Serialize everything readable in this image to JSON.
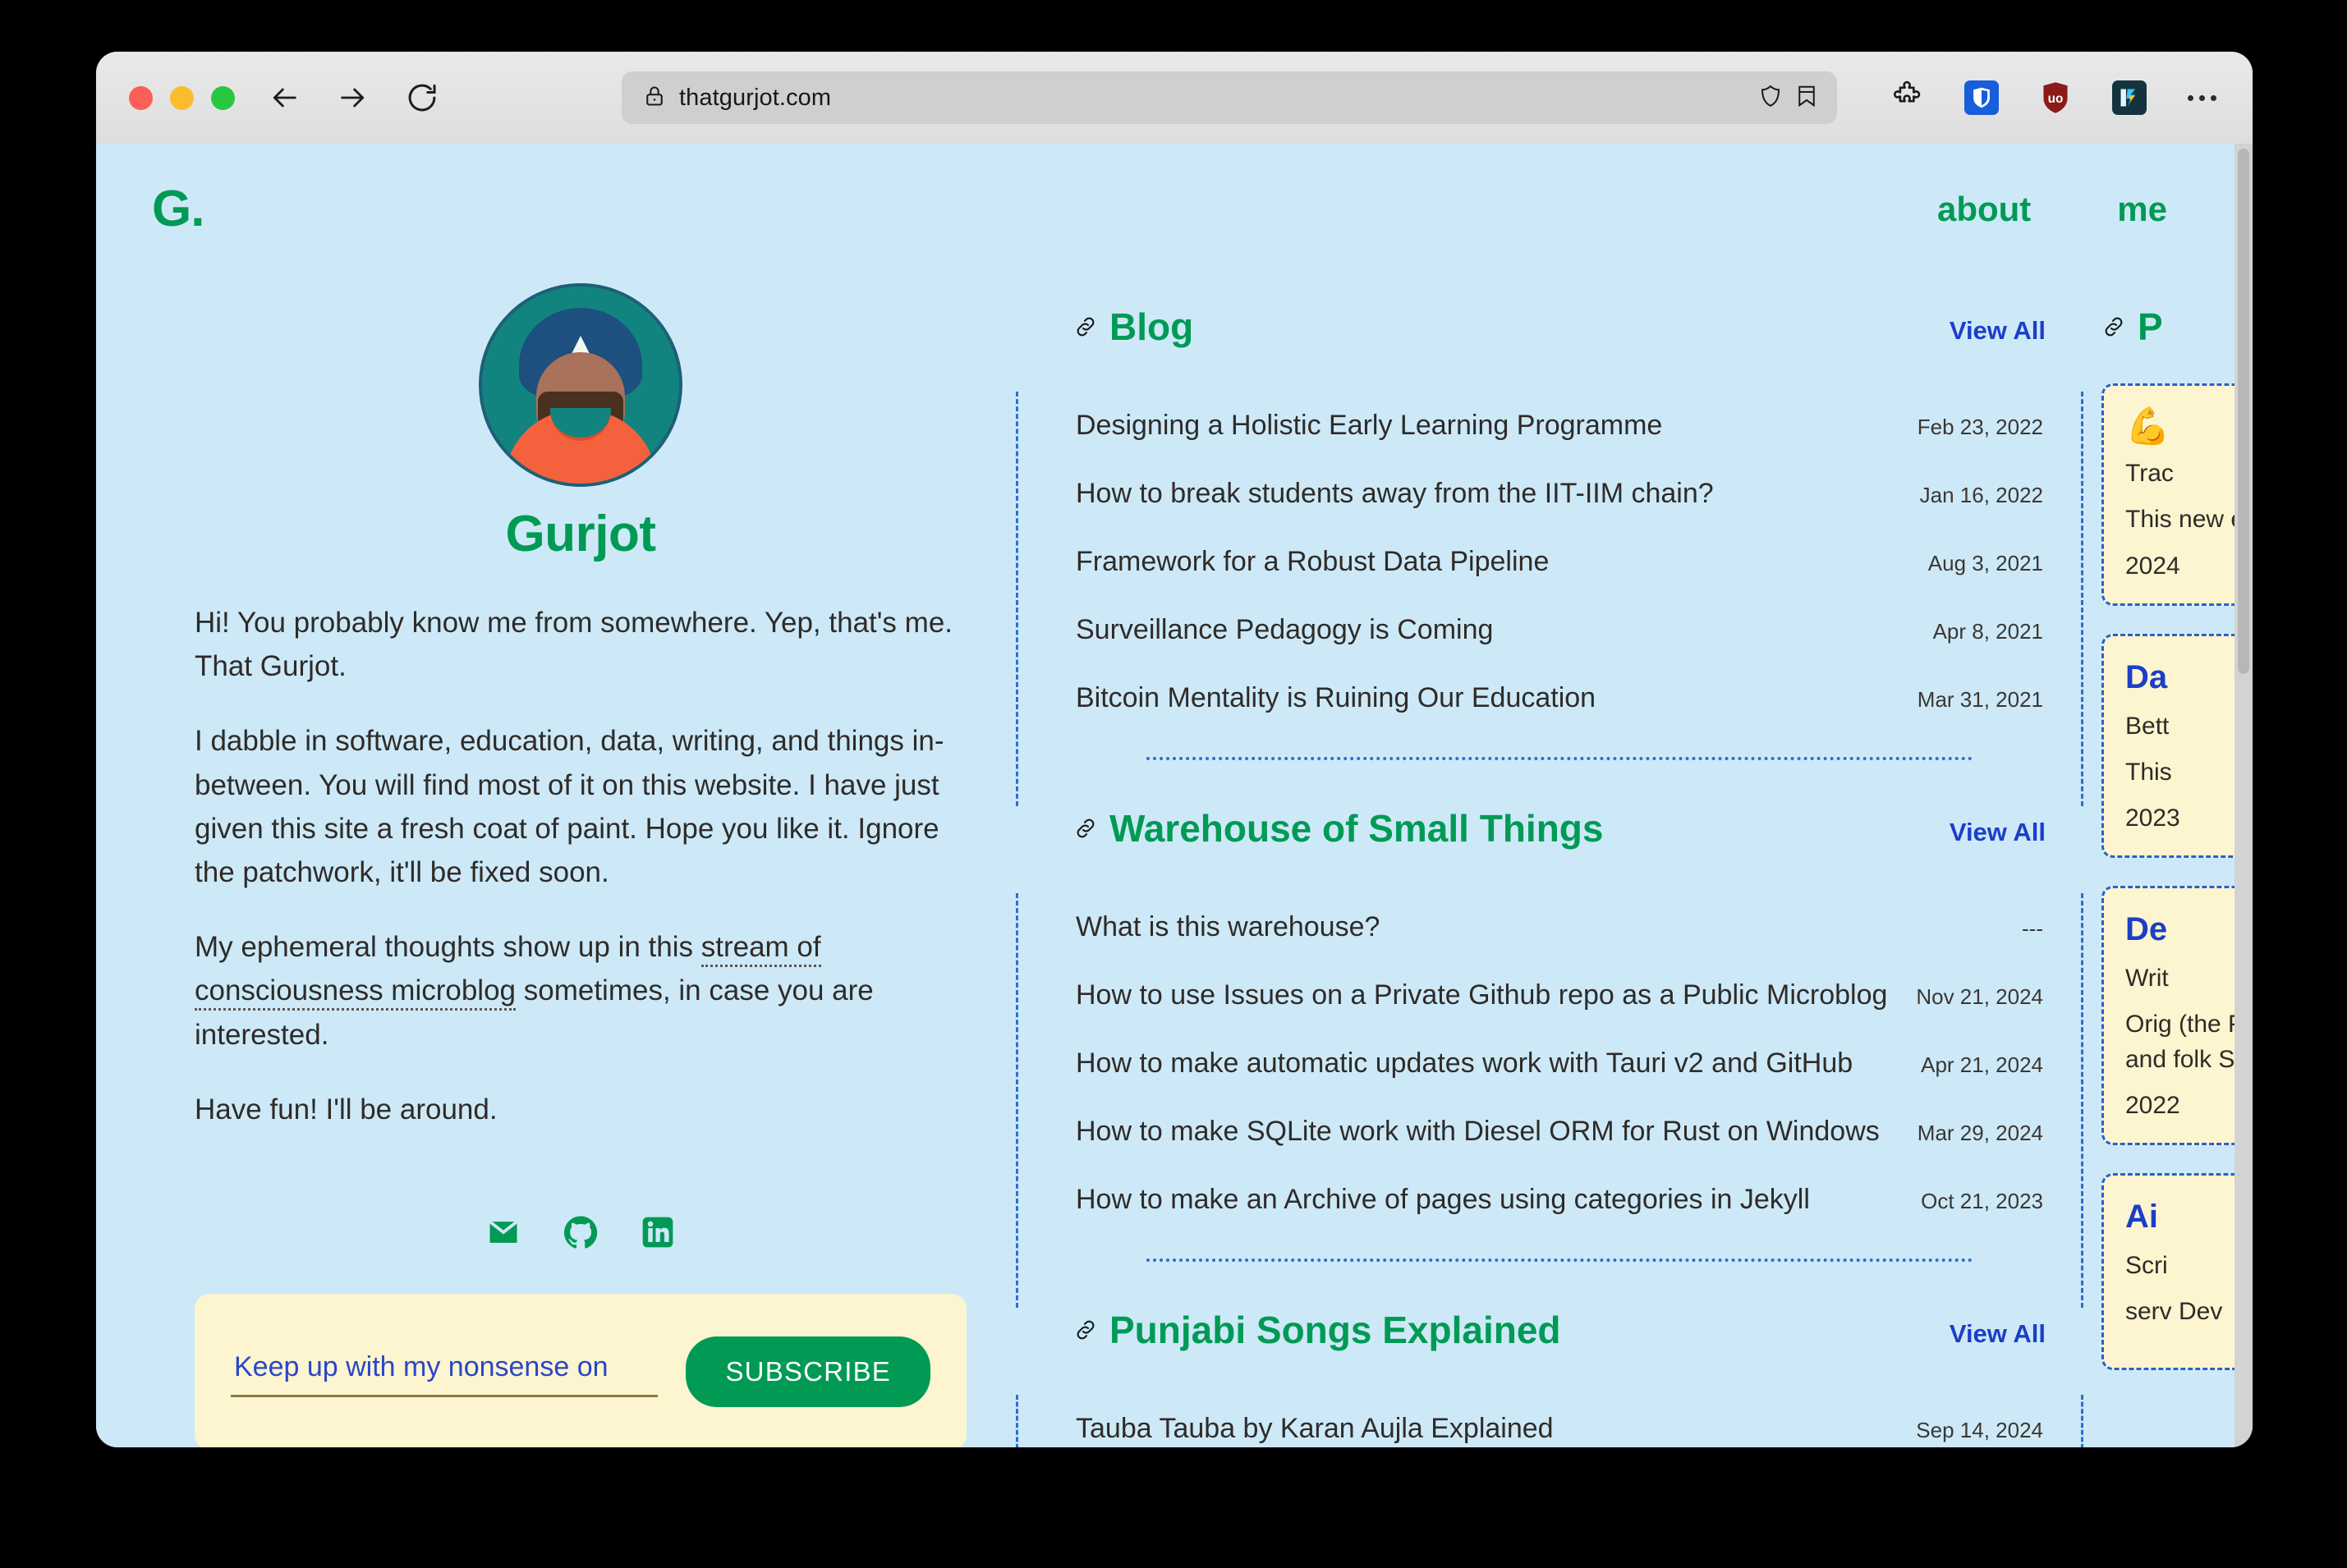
{
  "browser": {
    "url": "thatgurjot.com",
    "lock_icon": "lock-icon",
    "back_icon": "back-arrow-icon",
    "forward_icon": "forward-arrow-icon",
    "reload_icon": "reload-icon",
    "shield_icon": "shield-icon",
    "bookmark_icon": "bookmark-icon",
    "extensions_icon": "puzzle-piece-icon",
    "bitwarden_icon": "bitwarden-shield-icon",
    "ublock_icon": "ublock-origin-icon",
    "readwise_icon": "readwise-icon",
    "menu_icon": "more-menu-icon",
    "traffic_lights": {
      "close": "#fb5f57",
      "minimize": "#fcbc2f",
      "maximize": "#27c840"
    }
  },
  "theme": {
    "page_background": "#cde9f8",
    "accent_green": "#019a55",
    "link_blue": "#1b3ec9",
    "card_yellow": "#fcf5cf",
    "dashed_blue": "#2b6fd0",
    "text_dark": "#2f2b28"
  },
  "site_header": {
    "logo": "G.",
    "nav": [
      {
        "label": "about"
      },
      {
        "label": "me"
      }
    ]
  },
  "profile": {
    "avatar_icon": "avatar-illustration",
    "name": "Gurjot",
    "bio": [
      "Hi! You probably know me from somewhere. Yep, that's me. That Gurjot.",
      "I dabble in software, education, data, writing, and things in-between. You will find most of it on this website. I have just given this site a fresh coat of paint. Hope you like it. Ignore the patchwork, it'll be fixed soon.",
      "Have fun! I'll be around."
    ],
    "microblog_paragraph": {
      "before": "My ephemeral thoughts show up in this ",
      "link": "stream of consciousness microblog",
      "after": " sometimes, in case you are interested."
    },
    "socials": [
      {
        "name": "email-icon",
        "label": "Email"
      },
      {
        "name": "github-icon",
        "label": "GitHub"
      },
      {
        "name": "linkedin-icon",
        "label": "LinkedIn"
      }
    ]
  },
  "subscribe": {
    "placeholder": "Keep up with my nonsense on",
    "value": "",
    "button_label": "SUBSCRIBE"
  },
  "sections": [
    {
      "title": "Blog",
      "icon": "link-chain-icon",
      "view_all": "View All",
      "entries": [
        {
          "title": "Designing a Holistic Early Learning Programme",
          "date": "Feb 23, 2022"
        },
        {
          "title": "How to break students away from the IIT-IIM chain?",
          "date": "Jan 16, 2022"
        },
        {
          "title": "Framework for a Robust Data Pipeline",
          "date": "Aug 3, 2021"
        },
        {
          "title": "Surveillance Pedagogy is Coming",
          "date": "Apr 8, 2021"
        },
        {
          "title": "Bitcoin Mentality is Ruining Our Education",
          "date": "Mar 31, 2021"
        }
      ]
    },
    {
      "title": "Warehouse of Small Things",
      "icon": "link-chain-icon",
      "view_all": "View All",
      "entries": [
        {
          "title": "What is this warehouse?",
          "date": "---"
        },
        {
          "title": "How to use Issues on a Private Github repo as a Public Microblog",
          "date": "Nov 21, 2024"
        },
        {
          "title": "How to make automatic updates work with Tauri v2 and GitHub",
          "date": "Apr 21, 2024"
        },
        {
          "title": "How to make SQLite work with Diesel ORM for Rust on Windows",
          "date": "Mar 29, 2024"
        },
        {
          "title": "How to make an Archive of pages using categories in Jekyll",
          "date": "Oct 21, 2023"
        }
      ]
    },
    {
      "title": "Punjabi Songs Explained",
      "icon": "link-chain-icon",
      "view_all": "View All",
      "entries": [
        {
          "title": "Tauba Tauba by Karan Aujla Explained",
          "date": "Sep 14, 2024"
        }
      ]
    }
  ],
  "right_column": {
    "title": "P",
    "icon": "link-chain-icon",
    "cards": [
      {
        "emoji": "💪",
        "title": "",
        "sub": "Trac",
        "body": "This\nnew\nenti",
        "date": "2024"
      },
      {
        "emoji": "",
        "title": "Da",
        "sub": "Bett",
        "body": "This",
        "date": "2023"
      },
      {
        "emoji": "",
        "title": "De",
        "sub": "Writ",
        "body": "Orig\n(the\nPost\nand\nfolk\nSwif",
        "date": "2022"
      },
      {
        "emoji": "",
        "title": "Ai",
        "sub": "Scri",
        "body": "serv\n\nDev",
        "date": ""
      }
    ]
  }
}
